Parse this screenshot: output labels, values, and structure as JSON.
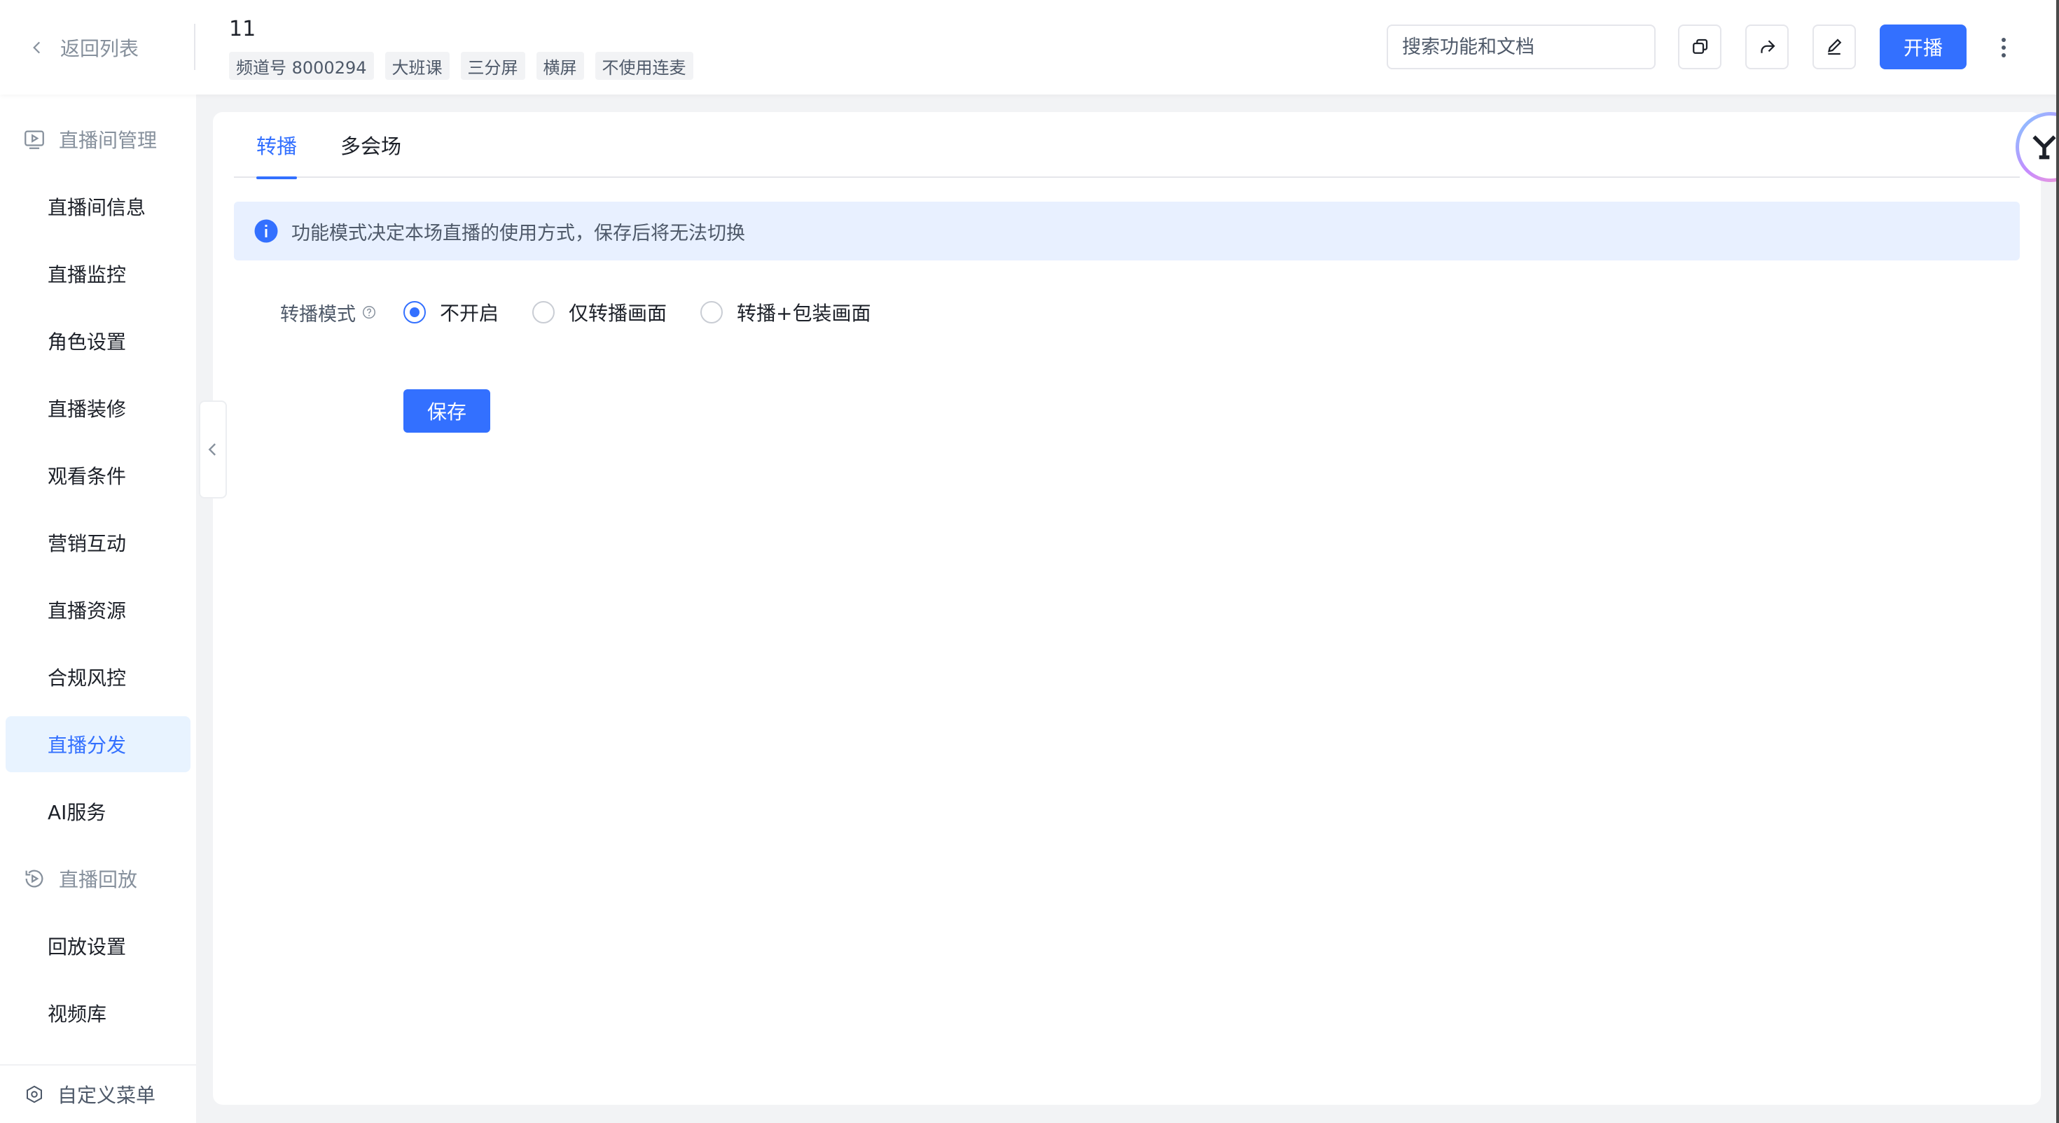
{
  "header": {
    "back_label": "返回列表",
    "room_title": "11",
    "tags": [
      "频道号 8000294",
      "大班课",
      "三分屏",
      "横屏",
      "不使用连麦"
    ],
    "search_placeholder": "搜索功能和文档",
    "start_button": "开播"
  },
  "sidebar": {
    "group_live": "直播间管理",
    "items_live": [
      "直播间信息",
      "直播监控",
      "角色设置",
      "直播装修",
      "观看条件",
      "营销互动",
      "直播资源",
      "合规风控",
      "直播分发",
      "AI服务"
    ],
    "active_item": "直播分发",
    "group_playback": "直播回放",
    "items_playback": [
      "回放设置",
      "视频库"
    ],
    "footer": "自定义菜单"
  },
  "main": {
    "tabs": [
      "转播",
      "多会场"
    ],
    "active_tab": "转播",
    "alert": "功能模式决定本场直播的使用方式，保存后将无法切换",
    "relay_mode_label": "转播模式",
    "relay_options": [
      "不开启",
      "仅转播画面",
      "转播+包装画面"
    ],
    "relay_selected": "不开启",
    "save_button": "保存"
  },
  "colors": {
    "primary": "#3370ff",
    "active_bg": "#e8f3ff",
    "alert_bg": "#e8f0ff"
  }
}
